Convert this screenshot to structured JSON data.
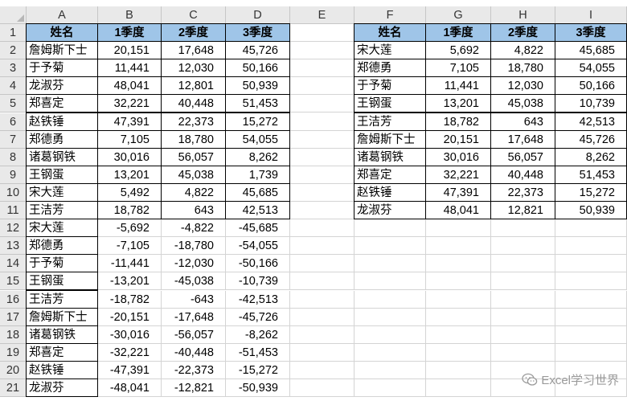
{
  "columns": [
    "A",
    "B",
    "C",
    "D",
    "E",
    "F",
    "G",
    "H",
    "I"
  ],
  "headers": [
    "姓名",
    "1季度",
    "2季度",
    "3季度"
  ],
  "left_table": [
    [
      "詹姆斯下士",
      "20,151",
      "17,648",
      "45,726"
    ],
    [
      "于予菊",
      "11,441",
      "12,030",
      "50,166"
    ],
    [
      "龙淑芬",
      "48,041",
      "12,801",
      "50,939"
    ],
    [
      "郑喜定",
      "32,221",
      "40,448",
      "51,453"
    ],
    [
      "赵铁锤",
      "47,391",
      "22,373",
      "15,272"
    ],
    [
      "郑德勇",
      "7,105",
      "18,780",
      "54,055"
    ],
    [
      "诸葛钢铁",
      "30,016",
      "56,057",
      "8,262"
    ],
    [
      "王钢蛋",
      "13,201",
      "45,038",
      "1,739"
    ],
    [
      "宋大莲",
      "5,492",
      "4,822",
      "45,685"
    ],
    [
      "王洁芳",
      "18,782",
      "643",
      "42,513"
    ]
  ],
  "lower_rows": [
    [
      "宋大莲",
      "-5,692",
      "-4,822",
      "-45,685"
    ],
    [
      "郑德勇",
      "-7,105",
      "-18,780",
      "-54,055"
    ],
    [
      "于予菊",
      "-11,441",
      "-12,030",
      "-50,166"
    ],
    [
      "王钢蛋",
      "-13,201",
      "-45,038",
      "-10,739"
    ],
    [
      "王洁芳",
      "-18,782",
      "-643",
      "-42,513"
    ],
    [
      "詹姆斯下士",
      "-20,151",
      "-17,648",
      "-45,726"
    ],
    [
      "诸葛钢铁",
      "-30,016",
      "-56,057",
      "-8,262"
    ],
    [
      "郑喜定",
      "-32,221",
      "-40,448",
      "-51,453"
    ],
    [
      "赵铁锤",
      "-47,391",
      "-22,373",
      "-15,272"
    ],
    [
      "龙淑芬",
      "-48,041",
      "-12,821",
      "-50,939"
    ]
  ],
  "right_table": [
    [
      "宋大莲",
      "5,692",
      "4,822",
      "45,685"
    ],
    [
      "郑德勇",
      "7,105",
      "18,780",
      "54,055"
    ],
    [
      "于予菊",
      "11,441",
      "12,030",
      "50,166"
    ],
    [
      "王钢蛋",
      "13,201",
      "45,038",
      "10,739"
    ],
    [
      "王洁芳",
      "18,782",
      "643",
      "42,513"
    ],
    [
      "詹姆斯下士",
      "20,151",
      "17,648",
      "45,726"
    ],
    [
      "诸葛钢铁",
      "30,016",
      "56,057",
      "8,262"
    ],
    [
      "郑喜定",
      "32,221",
      "40,448",
      "51,453"
    ],
    [
      "赵铁锤",
      "47,391",
      "22,373",
      "15,272"
    ],
    [
      "龙淑芬",
      "48,041",
      "12,821",
      "50,939"
    ]
  ],
  "watermark": "Excel学习世界",
  "colors": {
    "header_fill": "#9fc5e8",
    "grid_line": "#d4d4d4",
    "heading_bg": "#e9e9e9"
  }
}
